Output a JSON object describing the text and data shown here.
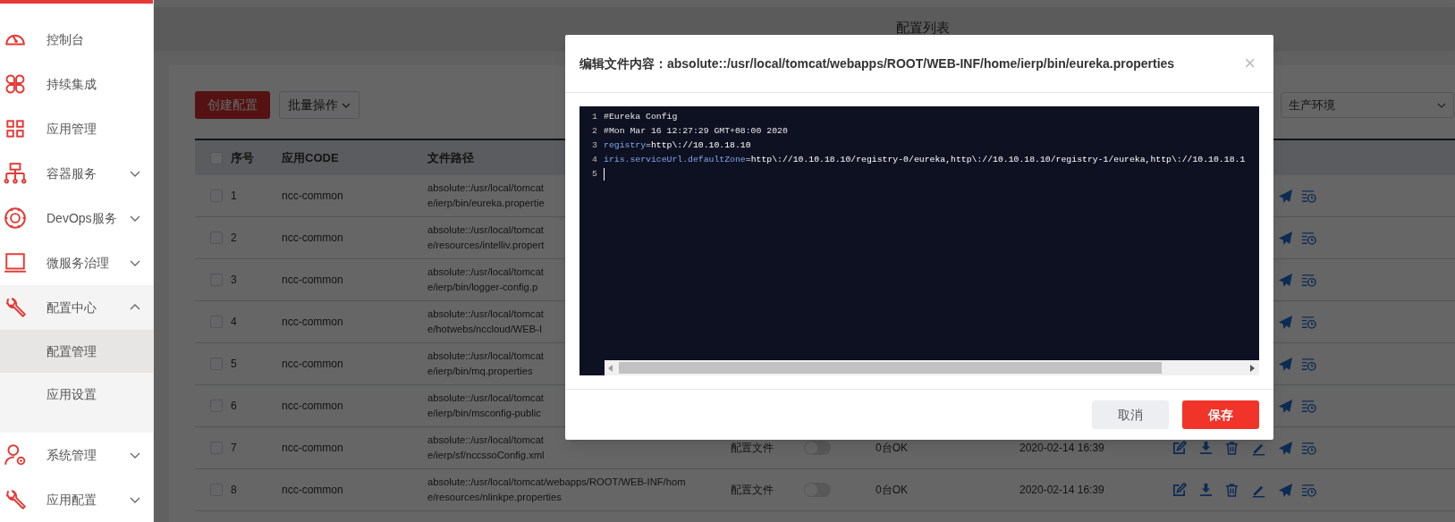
{
  "sidebar": {
    "items": [
      {
        "label": "控制台",
        "kind": "link",
        "selected": false
      },
      {
        "label": "持续集成",
        "kind": "link",
        "selected": false
      },
      {
        "label": "应用管理",
        "kind": "link",
        "selected": false
      },
      {
        "label": "容器服务",
        "kind": "group",
        "selected": false,
        "expanded": false
      },
      {
        "label": "DevOps服务",
        "kind": "group",
        "selected": false,
        "expanded": false
      },
      {
        "label": "微服务治理",
        "kind": "group",
        "selected": false,
        "expanded": false
      },
      {
        "label": "配置中心",
        "kind": "group",
        "selected": false,
        "expanded": true,
        "children": [
          {
            "label": "配置管理",
            "selected": true
          },
          {
            "label": "应用设置",
            "selected": false
          }
        ]
      },
      {
        "label": "系统管理",
        "kind": "group",
        "selected": false,
        "expanded": false
      },
      {
        "label": "应用配置",
        "kind": "group",
        "selected": false,
        "expanded": false
      }
    ]
  },
  "header": {
    "title": "配置列表"
  },
  "toolbar": {
    "create_button": "创建配置",
    "batch_button": "批量操作",
    "environment_select": "生产环境"
  },
  "table": {
    "columns": [
      "序号",
      "应用CODE",
      "文件路径"
    ],
    "header_checked": false,
    "rows": [
      {
        "index": "1",
        "app_code": "ncc-common",
        "path_lines": [
          "absolute::/usr/local/tomcat",
          "e/ierp/bin/eureka.propertie"
        ],
        "checked": false,
        "actions": [
          {
            "kind": "send"
          },
          {
            "kind": "history"
          }
        ]
      },
      {
        "index": "2",
        "app_code": "ncc-common",
        "path_lines": [
          "absolute::/usr/local/tomcat",
          "e/resources/intelliv.propert"
        ],
        "checked": false,
        "actions": [
          {
            "kind": "send"
          },
          {
            "kind": "history"
          }
        ]
      },
      {
        "index": "3",
        "app_code": "ncc-common",
        "path_lines": [
          "absolute::/usr/local/tomcat",
          "e/ierp/bin/logger-config.p"
        ],
        "checked": false,
        "actions": [
          {
            "kind": "send"
          },
          {
            "kind": "history"
          }
        ]
      },
      {
        "index": "4",
        "app_code": "ncc-common",
        "path_lines": [
          "absolute::/usr/local/tomcat",
          "e/hotwebs/nccloud/WEB-I"
        ],
        "checked": false,
        "actions": [
          {
            "kind": "send"
          },
          {
            "kind": "history"
          }
        ]
      },
      {
        "index": "5",
        "app_code": "ncc-common",
        "path_lines": [
          "absolute::/usr/local/tomcat",
          "e/ierp/bin/mq.properties"
        ],
        "checked": false,
        "actions": [
          {
            "kind": "send"
          },
          {
            "kind": "history"
          }
        ]
      },
      {
        "index": "6",
        "app_code": "ncc-common",
        "path_lines": [
          "absolute::/usr/local/tomcat",
          "e/ierp/bin/msconfig-public"
        ],
        "checked": false,
        "actions": [
          {
            "kind": "send"
          },
          {
            "kind": "history"
          }
        ]
      },
      {
        "index": "7",
        "app_code": "ncc-common",
        "path_lines": [
          "absolute::/usr/local/tomcat",
          "e/ierp/sf/nccssoConfig.xml"
        ],
        "checked": false,
        "type": "配置文件",
        "on": false,
        "status": "0台OK",
        "date": "2020-02-14 16:39",
        "actions": [
          {
            "kind": "edit"
          },
          {
            "kind": "download"
          },
          {
            "kind": "delete"
          },
          {
            "kind": "pen"
          },
          {
            "kind": "send"
          },
          {
            "kind": "history"
          }
        ]
      },
      {
        "index": "8",
        "app_code": "ncc-common",
        "path_lines": [
          "absolute::/usr/local/tomcat/webapps/ROOT/WEB-INF/hom",
          "e/resources/nlinkpe.properties"
        ],
        "checked": false,
        "type": "配置文件",
        "on": false,
        "status": "0台OK",
        "date": "2020-02-14 16:39",
        "actions": [
          {
            "kind": "edit"
          },
          {
            "kind": "download"
          },
          {
            "kind": "delete"
          },
          {
            "kind": "pen"
          },
          {
            "kind": "send"
          },
          {
            "kind": "history"
          }
        ]
      }
    ]
  },
  "modal": {
    "title": "编辑文件内容：absolute::/usr/local/tomcat/webapps/ROOT/WEB-INF/home/ierp/bin/eureka.properties",
    "close": "×",
    "lines": [
      {
        "number": "1",
        "parts": [
          {
            "kind": "comment",
            "text": "#Eureka Config"
          }
        ]
      },
      {
        "number": "2",
        "parts": [
          {
            "kind": "comment",
            "text": "#Mon Mar 16 12:27:29 GMT+08:00 2020"
          }
        ]
      },
      {
        "number": "3",
        "parts": [
          {
            "kind": "key",
            "text": "registry"
          },
          {
            "kind": "value",
            "text": "=http\\://10.10.18.10"
          }
        ]
      },
      {
        "number": "4",
        "parts": [
          {
            "kind": "key",
            "text": "iris.serviceUrl.defaultZone"
          },
          {
            "kind": "value",
            "text": "=http\\://10.10.18.10/registry-0/eureka,http\\://10.10.18.10/registry-1/eureka,http\\://10.10.18.1"
          }
        ]
      },
      {
        "number": "5",
        "cursor": true
      }
    ],
    "buttons": [
      {
        "label": "取消",
        "kind": "secondary"
      },
      {
        "label": "保存",
        "kind": "primary"
      }
    ]
  }
}
